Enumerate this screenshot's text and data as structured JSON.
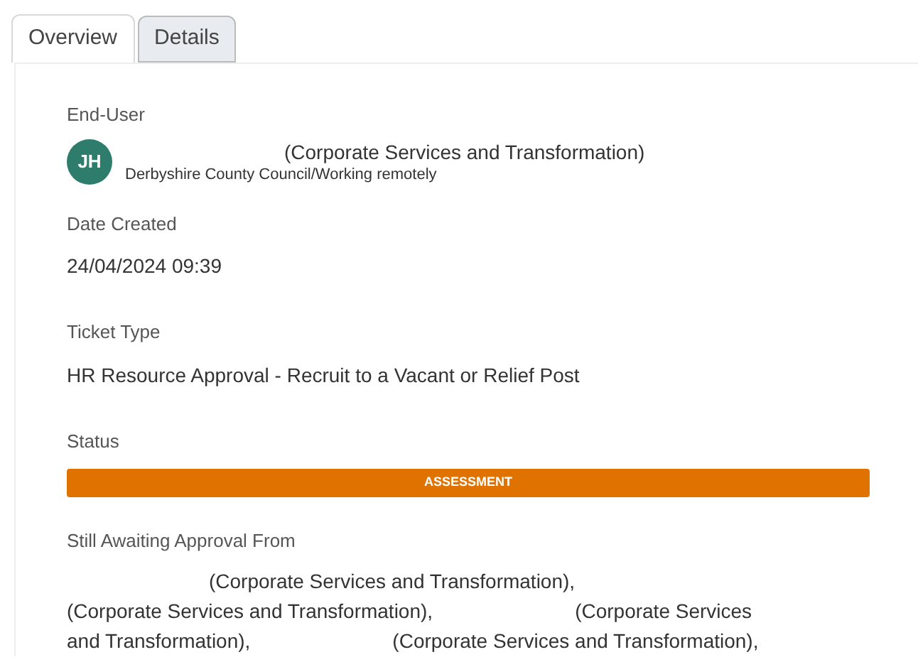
{
  "tabs": [
    {
      "label": "Overview",
      "selected": true
    },
    {
      "label": "Details",
      "selected": false
    }
  ],
  "end_user": {
    "label": "End-User",
    "initials": "JH",
    "department": "(Corporate Services and Transformation)",
    "location": "Derbyshire County Council/Working remotely"
  },
  "date_created": {
    "label": "Date Created",
    "value": "24/04/2024 09:39"
  },
  "ticket_type": {
    "label": "Ticket Type",
    "value": "HR Resource Approval - Recruit to a Vacant or Relief Post"
  },
  "status": {
    "label": "Status",
    "value": "ASSESSMENT",
    "color": "#e07200"
  },
  "awaiting": {
    "label": "Still Awaiting Approval From",
    "lines": [
      [
        "(Corporate Services and Transformation),"
      ],
      [
        "(Corporate Services and Transformation),",
        "(Corporate Services"
      ],
      [
        "and Transformation),",
        "(Corporate Services and Transformation),"
      ]
    ]
  }
}
